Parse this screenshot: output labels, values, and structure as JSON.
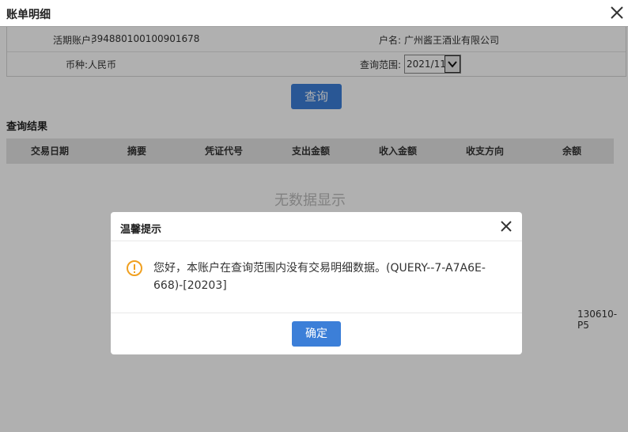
{
  "window": {
    "title": "账单明细",
    "close_icon": "close-icon"
  },
  "account_info": {
    "account_label": "活期账户:",
    "account_value": "394880100100901678",
    "name_label": "户名:",
    "name_value": "广州酱王酒业有限公司",
    "currency_label": "币种:",
    "currency_value": "人民币",
    "range_label": "查询范围:",
    "range_value": "2021/11"
  },
  "query_button": "查询",
  "results": {
    "title": "查询结果",
    "columns": [
      "交易日期",
      "摘要",
      "凭证代号",
      "支出金额",
      "收入金额",
      "收支方向",
      "余额"
    ],
    "empty_text": "无数据显示",
    "page_code": "130610-P5"
  },
  "dialog": {
    "title": "温馨提示",
    "message": "您好，本账户在查询范围内没有交易明细数据。(QUERY--7-A7A6E-668)-[20203]",
    "ok_label": "确定",
    "icon": "warning-icon"
  },
  "colors": {
    "primary_button": "#3c7fd8",
    "warning": "#f0a020",
    "overlay": "rgba(0,0,0,0.31)"
  }
}
